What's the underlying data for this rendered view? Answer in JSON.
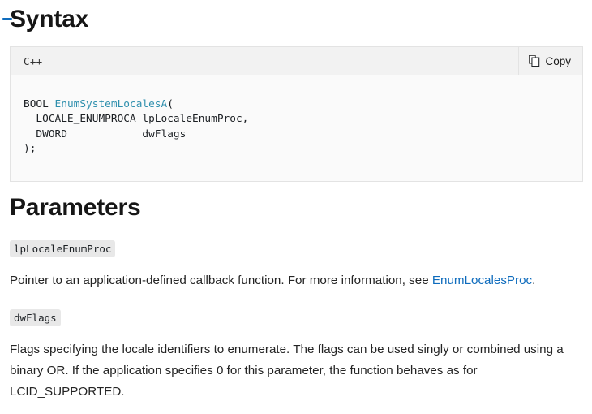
{
  "sections": {
    "syntax": {
      "heading": "Syntax",
      "anchor_icon": "anchor-link-icon"
    },
    "parameters": {
      "heading": "Parameters"
    }
  },
  "code_block": {
    "language_label": "C++",
    "copy_button": {
      "label": "Copy",
      "icon": "copy-icon"
    },
    "lines": [
      {
        "segments": [
          {
            "text": "BOOL ",
            "type": "plain"
          },
          {
            "text": "EnumSystemLocalesA",
            "type": "function"
          },
          {
            "text": "(",
            "type": "plain"
          }
        ]
      },
      {
        "segments": [
          {
            "text": "  LOCALE_ENUMPROCA lpLocaleEnumProc,",
            "type": "plain"
          }
        ]
      },
      {
        "segments": [
          {
            "text": "  DWORD            dwFlags",
            "type": "plain"
          }
        ]
      },
      {
        "segments": [
          {
            "text": ");",
            "type": "plain"
          }
        ]
      }
    ],
    "plain_text": "BOOL EnumSystemLocalesA(\n  LOCALE_ENUMPROCA lpLocaleEnumProc,\n  DWORD            dwFlags\n);"
  },
  "parameters": [
    {
      "name": "lpLocaleEnumProc",
      "description_before_link": "Pointer to an application-defined callback function. For more information, see ",
      "link_text": "EnumLocalesProc",
      "description_after_link": "."
    },
    {
      "name": "dwFlags",
      "description": "Flags specifying the locale identifiers to enumerate. The flags can be used singly or combined using a binary OR. If the application specifies 0 for this parameter, the function behaves as for LCID_SUPPORTED."
    }
  ],
  "colors": {
    "link": "#0f6cbd",
    "code_function": "#2e8fad",
    "code_text": "#1b1f23",
    "code_header_bg": "#f2f2f2",
    "code_body_bg": "#fafafa",
    "code_border": "#e3e3e3",
    "badge_bg": "#e8e8e8",
    "heading": "#161616",
    "body_text": "#242424"
  }
}
